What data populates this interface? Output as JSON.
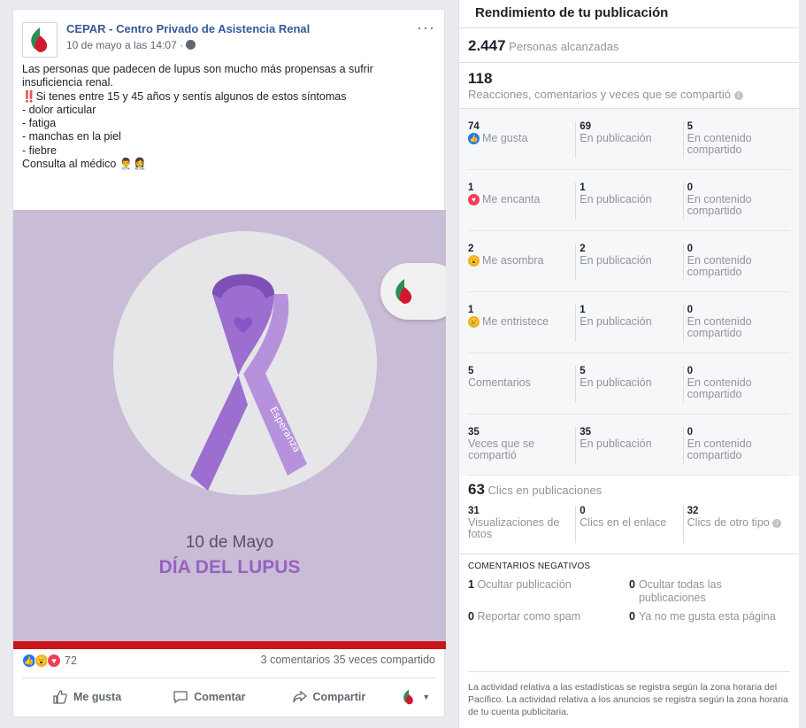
{
  "post": {
    "page_name": "CEPAR - Centro Privado de Asistencia Renal",
    "timestamp": "10 de mayo a las 14:07 · ",
    "text": "Las personas que padecen de lupus son mucho más propensas a sufrir insuficiencia renal.\n‼️Si tenes entre 15 y 45 años y sentís algunos de estos síntomas\n- dolor articular\n- fatiga\n- manchas en la piel\n- fiebre\nConsulta al médico 👨‍⚕️👩‍⚕️",
    "image": {
      "ribbon_text": "Esperanza",
      "date_text": "10 de Mayo",
      "day_text": "DÍA DEL LUPUS"
    },
    "reaction_count": "72",
    "comments_shares": "3 comentarios  35 veces compartido",
    "actions": {
      "like": "Me gusta",
      "comment": "Comentar",
      "share": "Compartir"
    },
    "more": "···"
  },
  "panel": {
    "title": "Rendimiento de tu publicación",
    "reach": {
      "value": "2.447",
      "label": "Personas alcanzadas"
    },
    "engagement": {
      "value": "118",
      "label": "Reacciones, comentarios y veces que se compartió"
    },
    "rows": [
      {
        "value": "74",
        "label": "Me gusta",
        "icon": "like-icon",
        "post_value": "69",
        "post_label": "En publicación",
        "shared_value": "5",
        "shared_label": "En contenido compartido"
      },
      {
        "value": "1",
        "label": "Me encanta",
        "icon": "love-icon",
        "post_value": "1",
        "post_label": "En publicación",
        "shared_value": "0",
        "shared_label": "En contenido compartido"
      },
      {
        "value": "2",
        "label": "Me asombra",
        "icon": "wow-icon",
        "post_value": "2",
        "post_label": "En publicación",
        "shared_value": "0",
        "shared_label": "En contenido compartido"
      },
      {
        "value": "1",
        "label": "Me entristece",
        "icon": "sad-icon",
        "post_value": "1",
        "post_label": "En publicación",
        "shared_value": "0",
        "shared_label": "En contenido compartido"
      },
      {
        "value": "5",
        "label": "Comentarios",
        "icon": "",
        "post_value": "5",
        "post_label": "En publicación",
        "shared_value": "0",
        "shared_label": "En contenido compartido"
      },
      {
        "value": "35",
        "label": "Veces que se compartió",
        "icon": "",
        "post_value": "35",
        "post_label": "En publicación",
        "shared_value": "0",
        "shared_label": "En contenido compartido"
      }
    ],
    "clicks": {
      "value": "63",
      "label": "Clics en publicaciones",
      "photo_value": "31",
      "photo_label": "Visualizaciones de fotos",
      "link_value": "0",
      "link_label": "Clics en el enlace",
      "other_value": "32",
      "other_label": "Clics de otro tipo"
    },
    "negative": {
      "title": "COMENTARIOS NEGATIVOS",
      "hide_post_value": "1",
      "hide_post_label": "Ocultar publicación",
      "hide_all_value": "0",
      "hide_all_label": "Ocultar todas las publicaciones",
      "spam_value": "0",
      "spam_label": "Reportar como spam",
      "unlike_value": "0",
      "unlike_label": "Ya no me gusta esta página"
    },
    "footnote": "La actividad relativa a las estadísticas se registra según la zona horaria del Pacífico. La actividad relativa a los anuncios se registra según la zona horaria de tu cuenta publicitaria."
  },
  "colors": {
    "link": "#385898",
    "like": "#2078f4",
    "love": "#f33e58",
    "wow": "#f7b125",
    "lupus_purple": "#9562c0",
    "red_bar": "#c9141b"
  }
}
